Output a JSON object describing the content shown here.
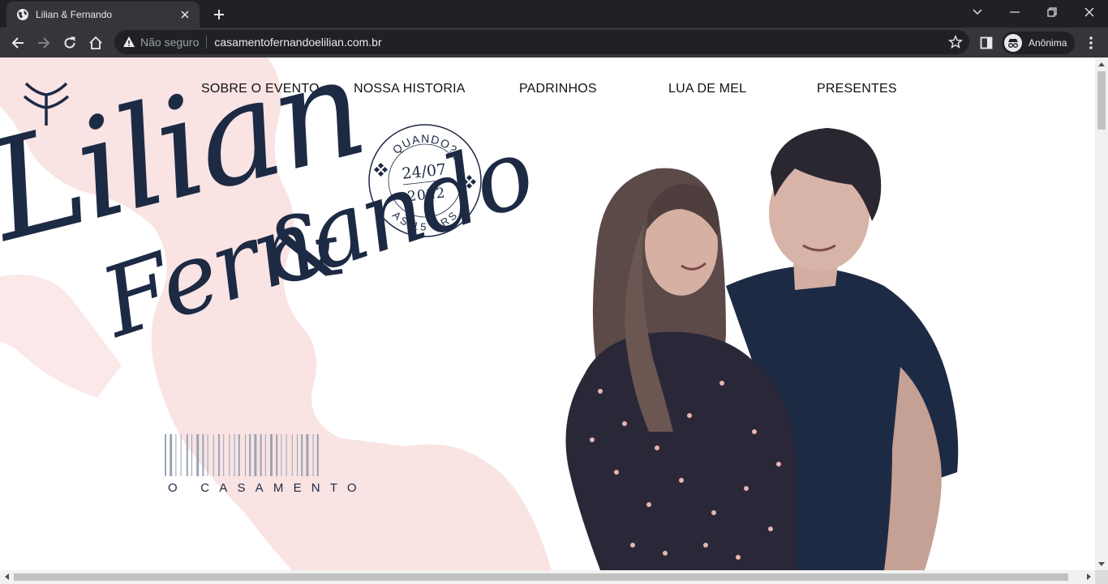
{
  "browser": {
    "tab_title": "Lilian & Fernando",
    "security_label": "Não seguro",
    "url": "casamentofernandoelilian.com.br",
    "profile_label": "Anônima"
  },
  "site": {
    "nav": [
      {
        "label": "SOBRE O EVENTO"
      },
      {
        "label": "NOSSA HISTORIA"
      },
      {
        "label": "PADRINHOS"
      },
      {
        "label": "LUA DE MEL"
      },
      {
        "label": "PRESENTES"
      }
    ],
    "stamp": {
      "top_text": "QUANDO?",
      "date": "24/07",
      "year": "2022",
      "bottom_text": "AS 15 HRS"
    },
    "name_first": "Lilian",
    "ampersand": "&",
    "name_second": "Fernando",
    "subtitle": "O CASAMENTO"
  },
  "colors": {
    "navy": "#1d2a44",
    "pink": "#f9e3e3"
  }
}
